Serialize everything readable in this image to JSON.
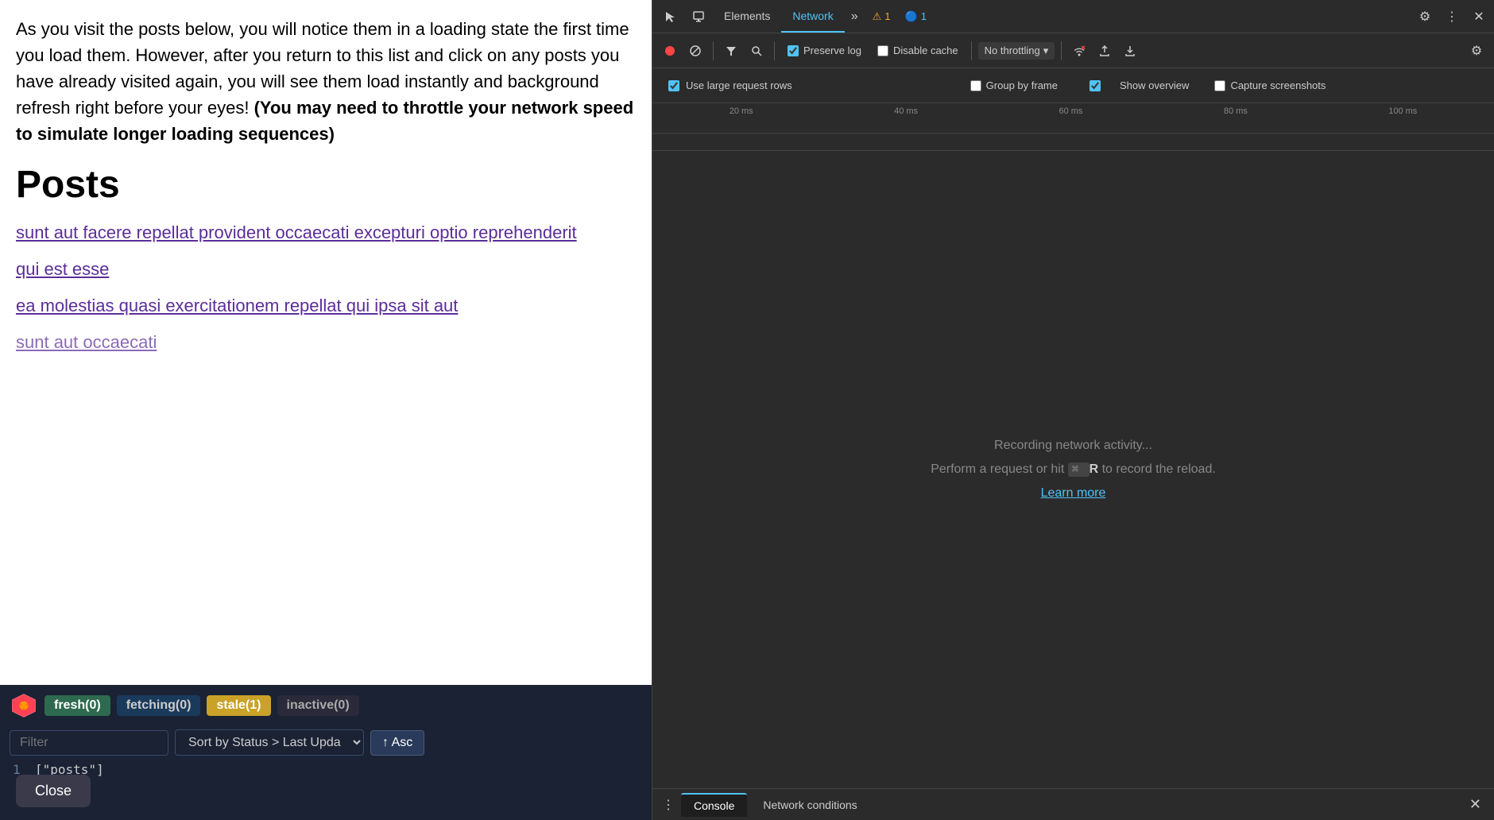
{
  "webpage": {
    "intro_text": "As you visit the posts below, you will notice them in a loading state the first time you load them. However, after you return to this list and click on any posts you have already visited again, you will see them load instantly and background refresh right before your eyes!",
    "intro_bold": "(You may need to throttle your network speed to simulate longer loading sequences)",
    "posts_heading": "Posts",
    "post_links": [
      "sunt aut facere repellat provident occaecati excepturi optio reprehenderit",
      "qui est esse",
      "ea molestias quasi exercitationem repellat qui ipsa sit aut",
      "sunt aut occaecati"
    ]
  },
  "devtools_bottom": {
    "badges": [
      {
        "label": "fresh",
        "count": 0,
        "type": "fresh"
      },
      {
        "label": "fetching",
        "count": 0,
        "type": "fetching"
      },
      {
        "label": "stale",
        "count": 1,
        "type": "stale"
      },
      {
        "label": "inactive",
        "count": 0,
        "type": "inactive"
      }
    ],
    "filter_placeholder": "Filter",
    "sort_label": "Sort by Status > Last Upda",
    "asc_label": "↑ Asc",
    "data_row": {
      "number": "1",
      "value": "[\"posts\"]"
    },
    "close_label": "Close"
  },
  "devtools_panel": {
    "tabs": [
      {
        "label": "Elements",
        "active": false
      },
      {
        "label": "Network",
        "active": true
      }
    ],
    "more_label": "»",
    "warn_badge": "1",
    "info_badge": "1",
    "toolbar": {
      "record_tooltip": "Record network log",
      "clear_tooltip": "Clear",
      "filter_tooltip": "Filter",
      "search_tooltip": "Search",
      "preserve_log_label": "Preserve log",
      "disable_cache_label": "Disable cache",
      "throttle_label": "No throttling",
      "upload_tooltip": "Import HAR file",
      "download_tooltip": "Export HAR file"
    },
    "options": {
      "use_large_rows": true,
      "use_large_rows_label": "Use large request rows",
      "group_by_frame": false,
      "group_by_frame_label": "Group by frame",
      "show_overview": true,
      "show_overview_label": "Show overview",
      "capture_screenshots": false,
      "capture_screenshots_label": "Capture screenshots"
    },
    "timeline": {
      "labels": [
        "20 ms",
        "40 ms",
        "60 ms",
        "80 ms",
        "100 ms"
      ]
    },
    "main": {
      "recording_text": "Recording network activity...",
      "perform_text_prefix": "Perform a request or hit",
      "cmd_symbol": "⌘",
      "perform_text_key": "R",
      "perform_text_suffix": "to record the reload.",
      "learn_more": "Learn more"
    },
    "bottom_bar": {
      "console_label": "Console",
      "network_conditions_label": "Network conditions"
    }
  }
}
